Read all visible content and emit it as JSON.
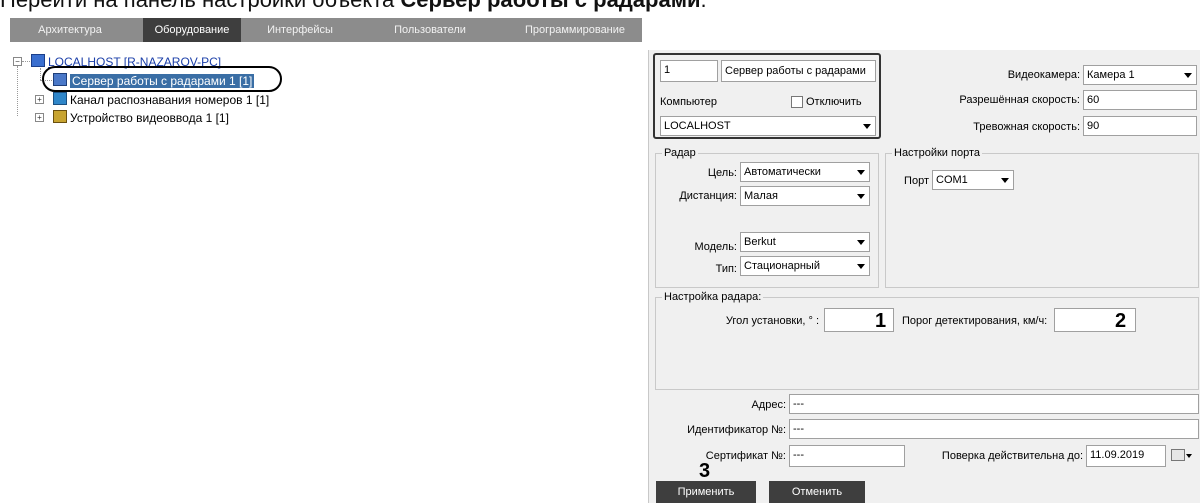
{
  "caption": {
    "prefix": "Перейти на панель настройки объекта ",
    "bold": "Сервер работы с радарами",
    "suffix": "."
  },
  "tabs": [
    "Архитектура",
    "Оборудование",
    "Интерфейсы",
    "Пользователи",
    "Программирование"
  ],
  "tree": {
    "root": "LOCALHOST [R-NAZAROV-PC]",
    "items": [
      "Сервер работы с радарами 1 [1]",
      "Канал распознавания номеров 1 [1]",
      "Устройство видеоввода 1 [1]"
    ]
  },
  "object": {
    "id": "1",
    "name": "Сервер работы с радарами",
    "computer_label": "Компьютер",
    "disable_label": "Отключить",
    "computer": "LOCALHOST"
  },
  "camera": {
    "label": "Видеокамера:",
    "value": "Камера 1"
  },
  "allowed_speed": {
    "label": "Разрешённая скорость:",
    "value": "60"
  },
  "alarm_speed": {
    "label": "Тревожная скорость:",
    "value": "90"
  },
  "radar": {
    "title": "Радар",
    "target_label": "Цель:",
    "target": "Автоматически",
    "distance_label": "Дистанция:",
    "distance": "Малая",
    "model_label": "Модель:",
    "model": "Berkut",
    "type_label": "Тип:",
    "type": "Стационарный"
  },
  "port": {
    "title": "Настройки порта",
    "label": "Порт",
    "value": "COM1"
  },
  "radar_setup": {
    "title": "Настройка радара:",
    "angle_label": "Угол установки, ° :",
    "angle_marker": "1",
    "threshold_label": "Порог детектирования, км/ч:",
    "threshold_marker": "2"
  },
  "address": {
    "label": "Адрес:",
    "value": "---"
  },
  "identifier": {
    "label": "Идентификатор №:",
    "value": "---"
  },
  "certificate": {
    "label": "Сертификат №:",
    "value": "---"
  },
  "verification": {
    "label": "Поверка действительна до:",
    "value": "11.09.2019"
  },
  "buttons": {
    "apply": "Применить",
    "cancel": "Отменить",
    "apply_marker": "3"
  }
}
